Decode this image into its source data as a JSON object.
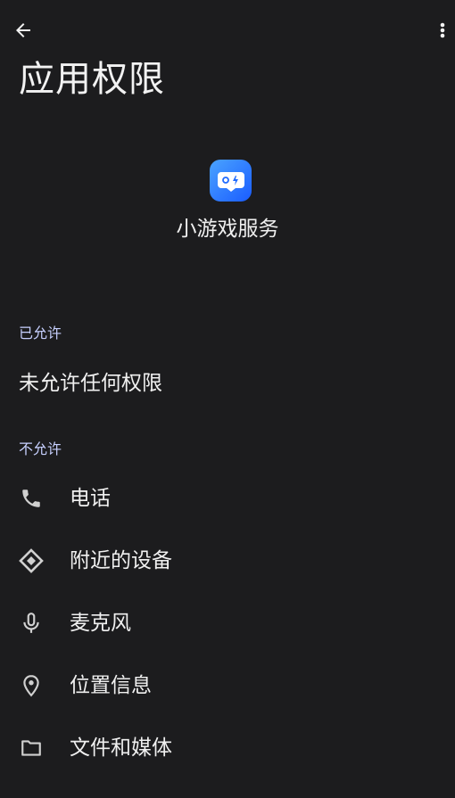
{
  "toolbar": {
    "back_icon": "arrow-left-icon",
    "more_icon": "more-vertical-icon"
  },
  "page": {
    "title": "应用权限"
  },
  "app": {
    "name": "小游戏服务",
    "icon": "gamepad-icon",
    "icon_gradient": [
      "#4aa3ff",
      "#1a5cff"
    ]
  },
  "sections": {
    "allowed": {
      "label": "已允许",
      "empty_text": "未允许任何权限"
    },
    "denied": {
      "label": "不允许",
      "items": [
        {
          "label": "电话",
          "icon": "phone-icon"
        },
        {
          "label": "附近的设备",
          "icon": "nearby-devices-icon"
        },
        {
          "label": "麦克风",
          "icon": "microphone-icon"
        },
        {
          "label": "位置信息",
          "icon": "location-pin-icon"
        },
        {
          "label": "文件和媒体",
          "icon": "folder-icon"
        }
      ]
    }
  },
  "colors": {
    "background": "#1c1c1e",
    "section_label": "#c7d0ff",
    "text": "#f0f0f0",
    "icon": "#d0d0d0"
  }
}
